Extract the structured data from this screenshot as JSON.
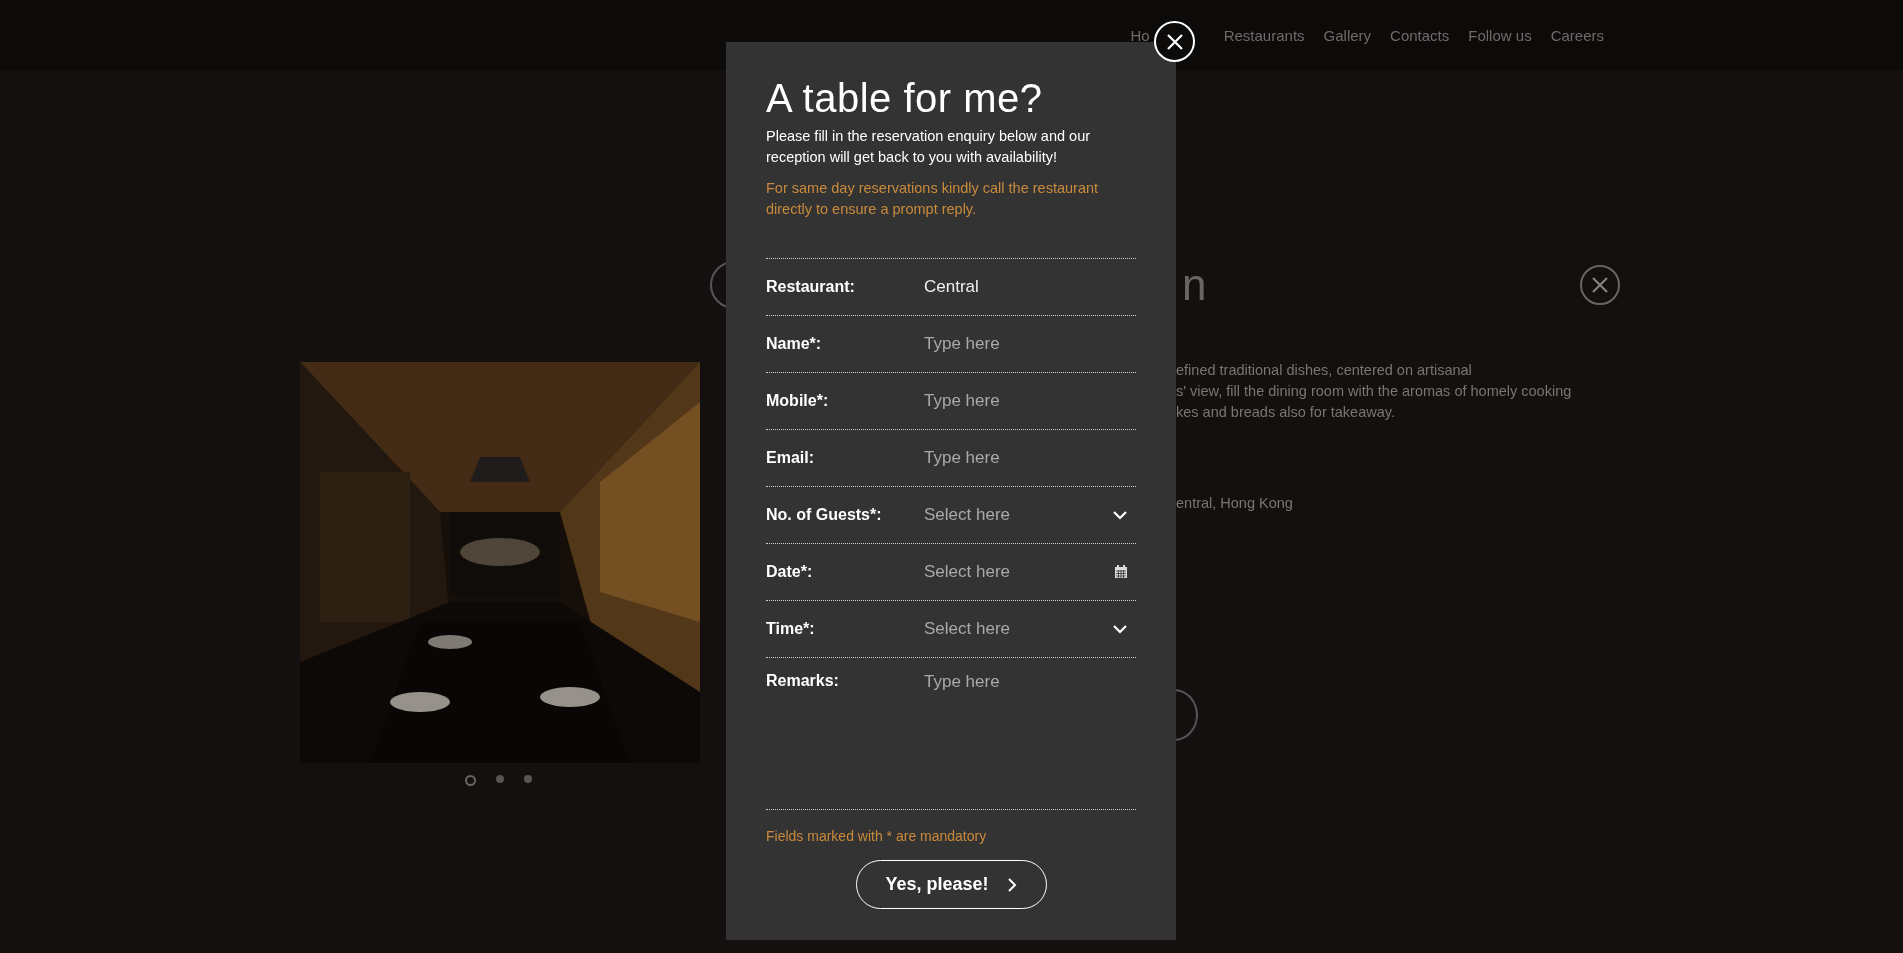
{
  "nav": [
    {
      "label": "Ho"
    },
    {
      "label": "Restaurants"
    },
    {
      "label": "Gallery"
    },
    {
      "label": "Contacts"
    },
    {
      "label": "Follow us"
    },
    {
      "label": "Careers"
    }
  ],
  "background": {
    "heading_fragment": "n",
    "description": [
      "efined traditional dishes, centered on artisanal",
      "s' view, fill the dining room with the aromas of homely cooking",
      "kes and breads also for takeaway."
    ],
    "address": "entral, Hong Kong"
  },
  "gallery": {
    "dots": [
      {
        "selected": true
      },
      {
        "selected": false
      },
      {
        "selected": false
      }
    ]
  },
  "modal": {
    "title": "A table for me?",
    "intro": "Please fill in the reservation enquiry below and our reception will get back to you with availability!",
    "notice": "For same day reservations kindly call the restaurant directly to ensure a prompt reply.",
    "fields": [
      {
        "label": "Restaurant:",
        "kind": "static",
        "value": "Central"
      },
      {
        "label": "Name*:",
        "kind": "text",
        "placeholder": "Type here"
      },
      {
        "label": "Mobile*:",
        "kind": "text",
        "placeholder": "Type here"
      },
      {
        "label": "Email:",
        "kind": "text",
        "placeholder": "Type here"
      },
      {
        "label": "No. of Guests*:",
        "kind": "select",
        "placeholder": "Select here"
      },
      {
        "label": "Date*:",
        "kind": "date",
        "placeholder": "Select here"
      },
      {
        "label": "Time*:",
        "kind": "select",
        "placeholder": "Select here"
      },
      {
        "label": "Remarks:",
        "kind": "textarea",
        "placeholder": "Type here"
      }
    ],
    "footnote": "Fields marked with * are mandatory",
    "submit": "Yes, please!"
  }
}
